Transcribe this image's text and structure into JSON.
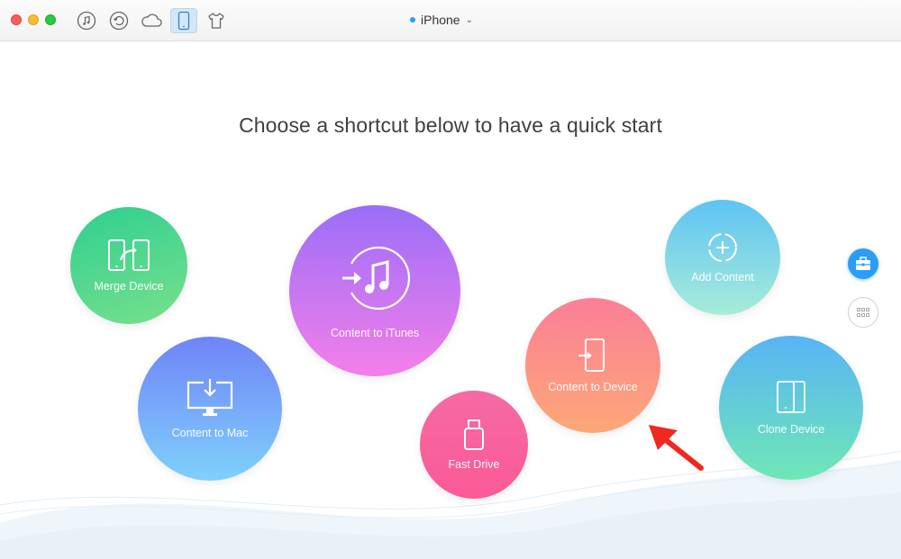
{
  "toolbar": {
    "icons": [
      "music-icon",
      "restore-icon",
      "cloud-icon",
      "phone-icon",
      "tshirt-icon"
    ],
    "active_icon": "phone-icon",
    "device_name": "iPhone"
  },
  "main": {
    "heading": "Choose a shortcut below to have a quick start",
    "shortcuts": {
      "merge_device": "Merge Device",
      "content_to_mac": "Content to Mac",
      "content_to_itunes": "Content to iTunes",
      "fast_drive": "Fast Drive",
      "content_to_device": "Content to Device",
      "add_content": "Add Content",
      "clone_device": "Clone Device"
    }
  },
  "sidebar": {
    "buttons": [
      "toolkit-icon",
      "grid-icon"
    ]
  },
  "colors": {
    "accent": "#2b9df4",
    "arrow": "#f0281e"
  }
}
